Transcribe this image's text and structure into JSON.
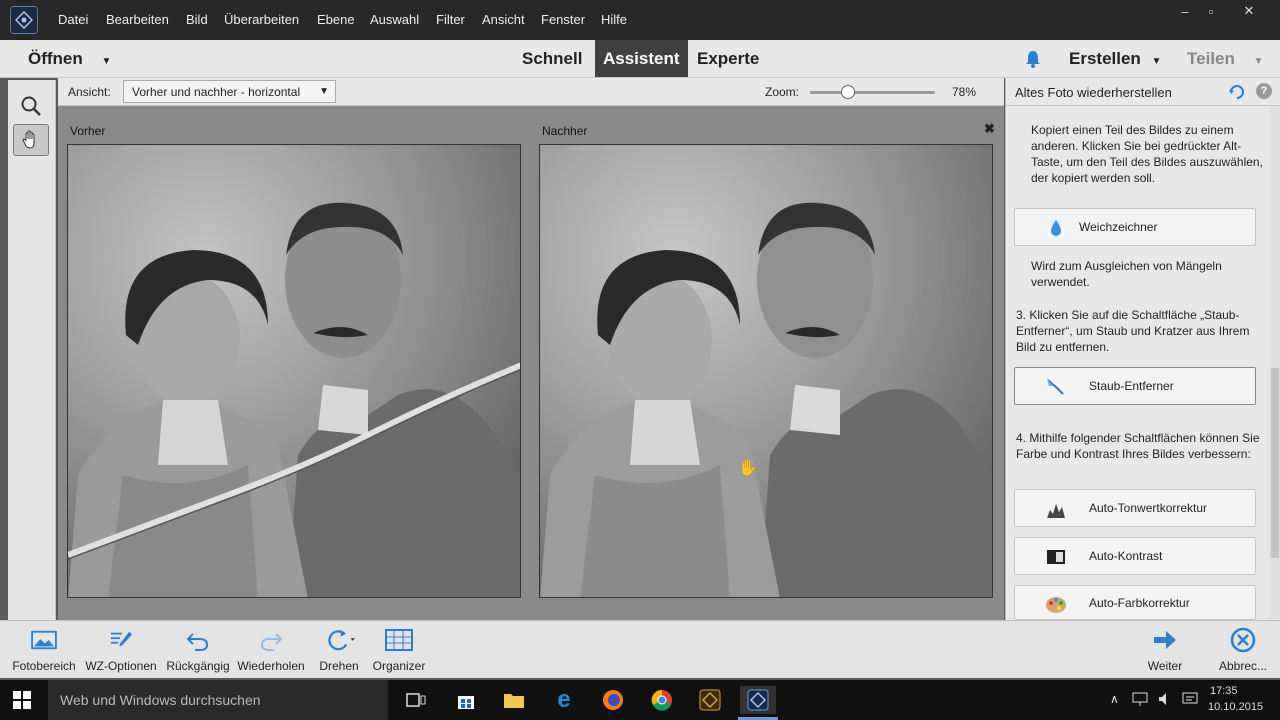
{
  "menubar": {
    "items": [
      "Datei",
      "Bearbeiten",
      "Bild",
      "Überarbeiten",
      "Ebene",
      "Auswahl",
      "Filter",
      "Ansicht",
      "Fenster",
      "Hilfe"
    ],
    "window_controls": [
      "–",
      "▫",
      "✕"
    ]
  },
  "modebar": {
    "open_label": "Öffnen",
    "tabs": [
      "Schnell",
      "Assistent",
      "Experte"
    ],
    "active_tab": "Assistent",
    "create_label": "Erstellen",
    "share_label": "Teilen"
  },
  "options": {
    "view_label": "Ansicht:",
    "view_value": "Vorher und nachher - horizontal",
    "zoom_label": "Zoom:",
    "zoom_value": "78%",
    "zoom_fraction": 0.3
  },
  "canvas": {
    "before_label": "Vorher",
    "after_label": "Nachher",
    "close_glyph": "✖"
  },
  "panel": {
    "title": "Altes Foto wiederherstellen",
    "text1": "Kopiert einen Teil des Bildes zu einem anderen. Klicken Sie bei gedrückter Alt-Taste, um den Teil des Bildes auszuwählen, der kopiert werden soll.",
    "blur_button": "Weichzeichner",
    "text2": "Wird zum Ausgleichen von Mängeln verwendet.",
    "step3": "3. Klicken Sie auf die Schaltfläche „Staub-Entferner“, um Staub und Kratzer aus Ihrem Bild zu entfernen.",
    "dust_button": "Staub-Entferner",
    "step4": "4. Mithilfe folgender Schaltflächen können Sie Farbe und Kontrast Ihres Bildes verbessern:",
    "auto_levels": "Auto-Tonwertkorrektur",
    "auto_contrast": "Auto-Kontrast",
    "auto_color": "Auto-Farbkorrektur"
  },
  "bottombar": {
    "photo_bin": "Fotobereich",
    "tool_options": "WZ-Optionen",
    "undo": "Rückgängig",
    "redo": "Wiederholen",
    "rotate": "Drehen",
    "organizer": "Organizer",
    "next": "Weiter",
    "cancel": "Abbrec..."
  },
  "taskbar": {
    "search_placeholder": "Web und Windows durchsuchen",
    "time": "17:35",
    "date": "10.10.2015"
  },
  "colors": {
    "accent_blue": "#2a7fd4",
    "active_tab": "#404040"
  }
}
